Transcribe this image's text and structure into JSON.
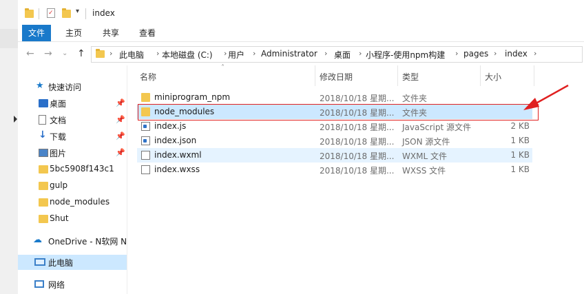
{
  "window": {
    "title": "index"
  },
  "ribbon": {
    "tabs": [
      "文件",
      "主页",
      "共享",
      "查看"
    ]
  },
  "address": {
    "crumbs": [
      "此电脑",
      "本地磁盘 (C:)",
      "用户",
      "Administrator",
      "桌面",
      "小程序-使用npm构建",
      "pages",
      "index"
    ]
  },
  "nav": {
    "quick_access": "快速访问",
    "items": [
      {
        "label": "桌面",
        "icon": "desktop-icon",
        "pinned": true
      },
      {
        "label": "文档",
        "icon": "document-icon",
        "pinned": true
      },
      {
        "label": "下载",
        "icon": "download-icon",
        "pinned": true
      },
      {
        "label": "图片",
        "icon": "picture-icon",
        "pinned": true
      },
      {
        "label": "5bc5908f143c1",
        "icon": "folder-icon",
        "pinned": false
      },
      {
        "label": "gulp",
        "icon": "folder-icon",
        "pinned": false
      },
      {
        "label": "node_modules",
        "icon": "folder-icon",
        "pinned": false
      },
      {
        "label": "Shut",
        "icon": "folder-icon",
        "pinned": false
      }
    ],
    "onedrive": "OneDrive - N软网 N",
    "this_pc": "此电脑",
    "network": "网络"
  },
  "filelist": {
    "columns": [
      "名称",
      "修改日期",
      "类型",
      "大小"
    ],
    "rows": [
      {
        "name": "miniprogram_npm",
        "date": "2018/10/18 星期...",
        "type": "文件夹",
        "size": "",
        "icon": "folder-icon"
      },
      {
        "name": "node_modules",
        "date": "2018/10/18 星期...",
        "type": "文件夹",
        "size": "",
        "icon": "folder-icon"
      },
      {
        "name": "index.js",
        "date": "2018/10/18 星期...",
        "type": "JavaScript 源文件",
        "size": "2 KB",
        "icon": "js-file-icon"
      },
      {
        "name": "index.json",
        "date": "2018/10/18 星期...",
        "type": "JSON 源文件",
        "size": "1 KB",
        "icon": "json-file-icon"
      },
      {
        "name": "index.wxml",
        "date": "2018/10/18 星期...",
        "type": "WXML 文件",
        "size": "1 KB",
        "icon": "file-icon"
      },
      {
        "name": "index.wxss",
        "date": "2018/10/18 星期...",
        "type": "WXSS 文件",
        "size": "1 KB",
        "icon": "file-icon"
      }
    ]
  },
  "colors": {
    "accent": "#1979ca",
    "selected": "#cce8ff",
    "hover": "#e5f3ff",
    "annotation": "#e02020"
  }
}
